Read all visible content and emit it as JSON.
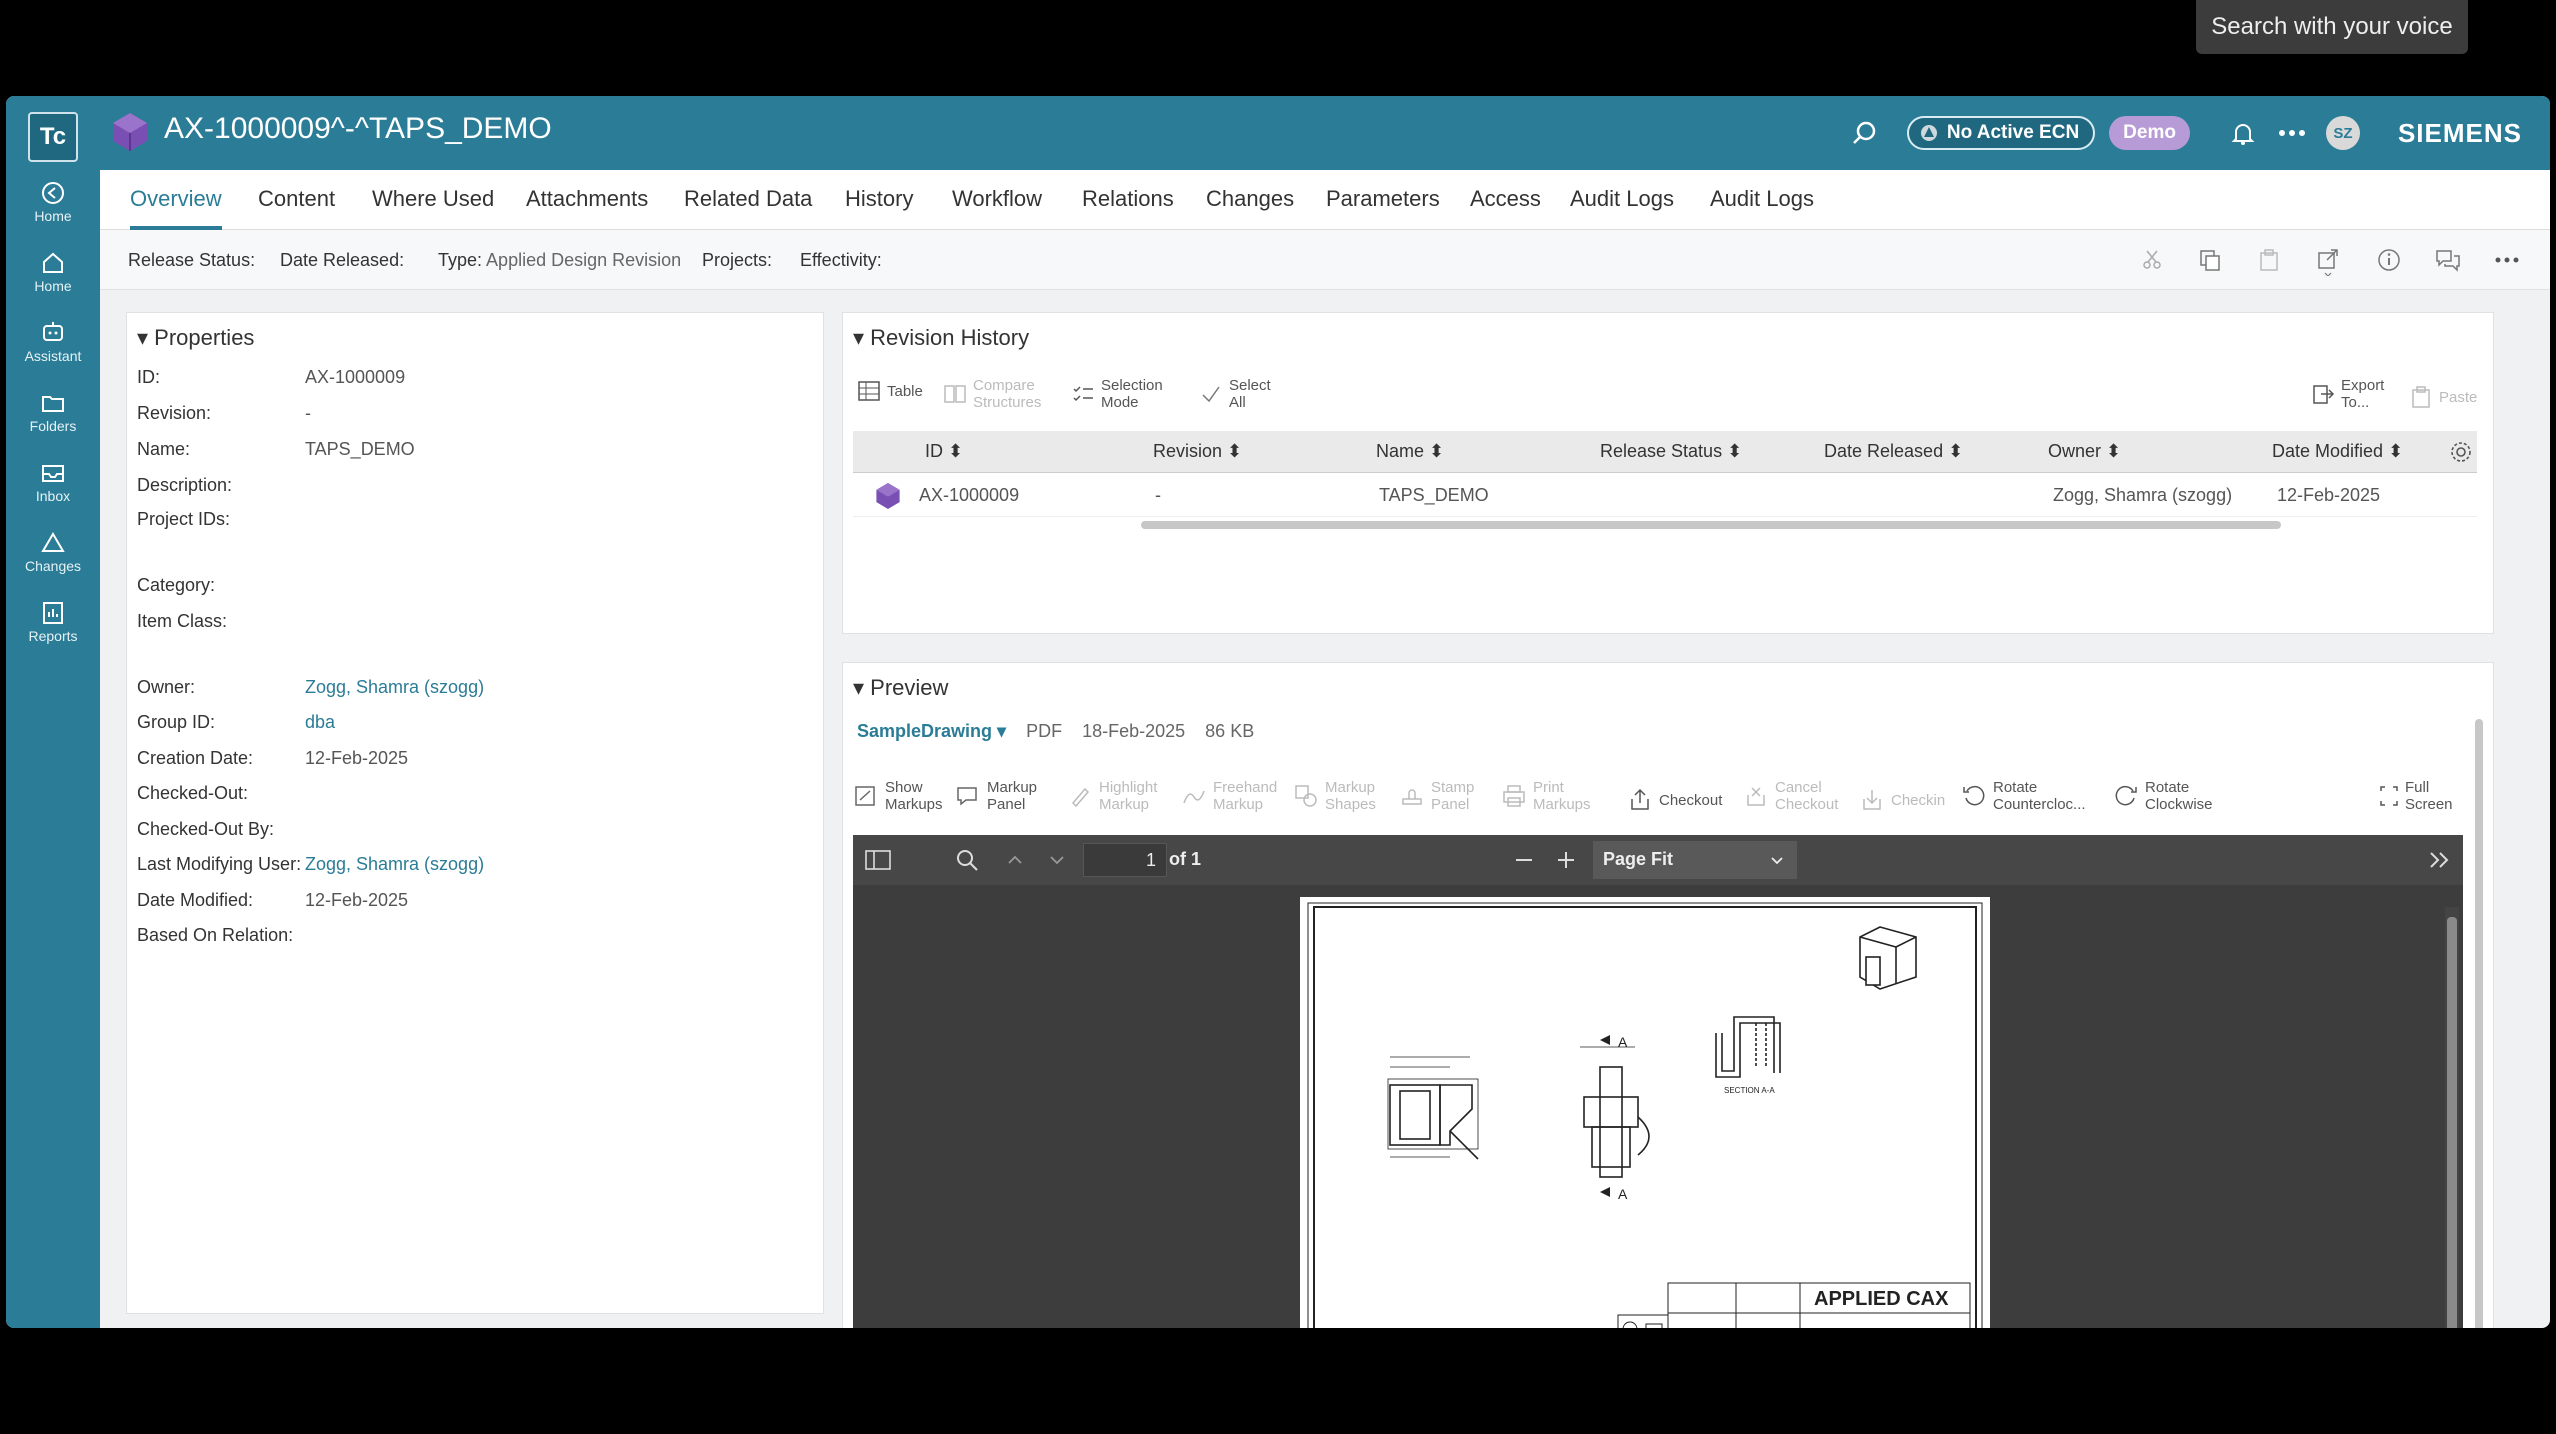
{
  "voice_tooltip": "Search with your voice",
  "sidebar": {
    "logo": "Tc",
    "items": [
      {
        "label": "Home",
        "icon": "back-home-icon"
      },
      {
        "label": "Home",
        "icon": "home-icon"
      },
      {
        "label": "Assistant",
        "icon": "assistant-icon"
      },
      {
        "label": "Folders",
        "icon": "folder-icon"
      },
      {
        "label": "Inbox",
        "icon": "inbox-icon"
      },
      {
        "label": "Changes",
        "icon": "changes-icon"
      },
      {
        "label": "Reports",
        "icon": "reports-icon"
      }
    ]
  },
  "header": {
    "title": "AX-1000009^-^TAPS_DEMO",
    "ecn_label": "No Active ECN",
    "demo_label": "Demo",
    "avatar": "SZ",
    "brand": "SIEMENS"
  },
  "tabs": [
    "Overview",
    "Content",
    "Where Used",
    "Attachments",
    "Related Data",
    "History",
    "Workflow",
    "Relations",
    "Changes",
    "Parameters",
    "Access",
    "Audit Logs",
    "Audit Logs"
  ],
  "info": {
    "release_status": "Release Status:",
    "date_released": "Date Released:",
    "type_label": "Type:",
    "type_value": "Applied Design Revision",
    "projects": "Projects:",
    "effectivity": "Effectivity:"
  },
  "properties": {
    "title": "Properties",
    "rows": [
      {
        "label": "ID:",
        "value": "AX-1000009"
      },
      {
        "label": "Revision:",
        "value": "-"
      },
      {
        "label": "Name:",
        "value": "TAPS_DEMO"
      },
      {
        "label": "Description:",
        "value": ""
      },
      {
        "label": "Project IDs:",
        "value": ""
      },
      {
        "label": "Category:",
        "value": ""
      },
      {
        "label": "Item Class:",
        "value": ""
      },
      {
        "label": "Owner:",
        "value": "Zogg, Shamra (szogg)"
      },
      {
        "label": "Group ID:",
        "value": "dba"
      },
      {
        "label": "Creation Date:",
        "value": "12-Feb-2025"
      },
      {
        "label": "Checked-Out:",
        "value": ""
      },
      {
        "label": "Checked-Out By:",
        "value": ""
      },
      {
        "label": "Last Modifying User:",
        "value": "Zogg, Shamra (szogg)"
      },
      {
        "label": "Date Modified:",
        "value": "12-Feb-2025"
      },
      {
        "label": "Based On Relation:",
        "value": ""
      }
    ]
  },
  "revision_history": {
    "title": "Revision History",
    "tools": {
      "table": "Table",
      "compare1": "Compare",
      "compare2": "Structures",
      "selection1": "Selection",
      "selection2": "Mode",
      "select1": "Select",
      "select2": "All",
      "export1": "Export",
      "export2": "To...",
      "paste": "Paste"
    },
    "columns": [
      "ID",
      "Revision",
      "Name",
      "Release Status",
      "Date Released",
      "Owner",
      "Date Modified"
    ],
    "row": {
      "id": "AX-1000009",
      "revision": "-",
      "name": "TAPS_DEMO",
      "release_status": "",
      "date_released": "",
      "owner": "Zogg, Shamra (szogg)",
      "date_modified": "12-Feb-2025"
    }
  },
  "preview": {
    "title": "Preview",
    "file_name": "SampleDrawing",
    "file_type": "PDF",
    "file_date": "18-Feb-2025",
    "file_size": "86 KB",
    "tools": {
      "show1": "Show",
      "show2": "Markups",
      "markup1": "Markup",
      "markup2": "Panel",
      "highlight1": "Highlight",
      "highlight2": "Markup",
      "freehand1": "Freehand",
      "freehand2": "Markup",
      "shapes1": "Markup",
      "shapes2": "Shapes",
      "stamp1": "Stamp",
      "stamp2": "Panel",
      "print1": "Print",
      "print2": "Markups",
      "checkout": "Checkout",
      "cancel1": "Cancel",
      "cancel2": "Checkout",
      "checkin": "Checkin",
      "rotccw1": "Rotate",
      "rotccw2": "Counterclоc...",
      "rotcw1": "Rotate",
      "rotcw2": "Clockwise",
      "full1": "Full",
      "full2": "Screen"
    },
    "viewer": {
      "page_current": "1",
      "page_total": "of 1",
      "zoom": "Page Fit"
    },
    "drawing": {
      "company": "APPLIED CAX",
      "section_label": "SECTION A-A",
      "marker_a": "A"
    }
  }
}
